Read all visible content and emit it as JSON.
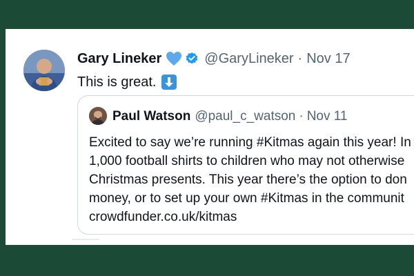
{
  "tweet": {
    "author_name": "Gary Lineker",
    "handle": "@GaryLineker",
    "separator": "·",
    "date": "Nov 17",
    "text": "This is great.",
    "icons": [
      "blue-heart-icon",
      "verified-badge-icon",
      "down-arrow-emoji-icon"
    ],
    "colors": {
      "verified": "#1d9bf0",
      "heart": "#5da9e9",
      "muted": "#536471",
      "text": "#0f1419"
    }
  },
  "quoted_tweet": {
    "author_name": "Paul Watson",
    "handle": "@paul_c_watson",
    "separator": "·",
    "date": "Nov 11",
    "lines": [
      "Excited to say we’re running #Kitmas again this year! In",
      "1,000 football shirts to children who may not otherwise",
      "Christmas presents. This year there’s the option to don",
      "money, or to set up your own #Kitmas in the communit",
      "crowdfunder.co.uk/kitmas"
    ]
  },
  "background_color": "#1b4a36"
}
